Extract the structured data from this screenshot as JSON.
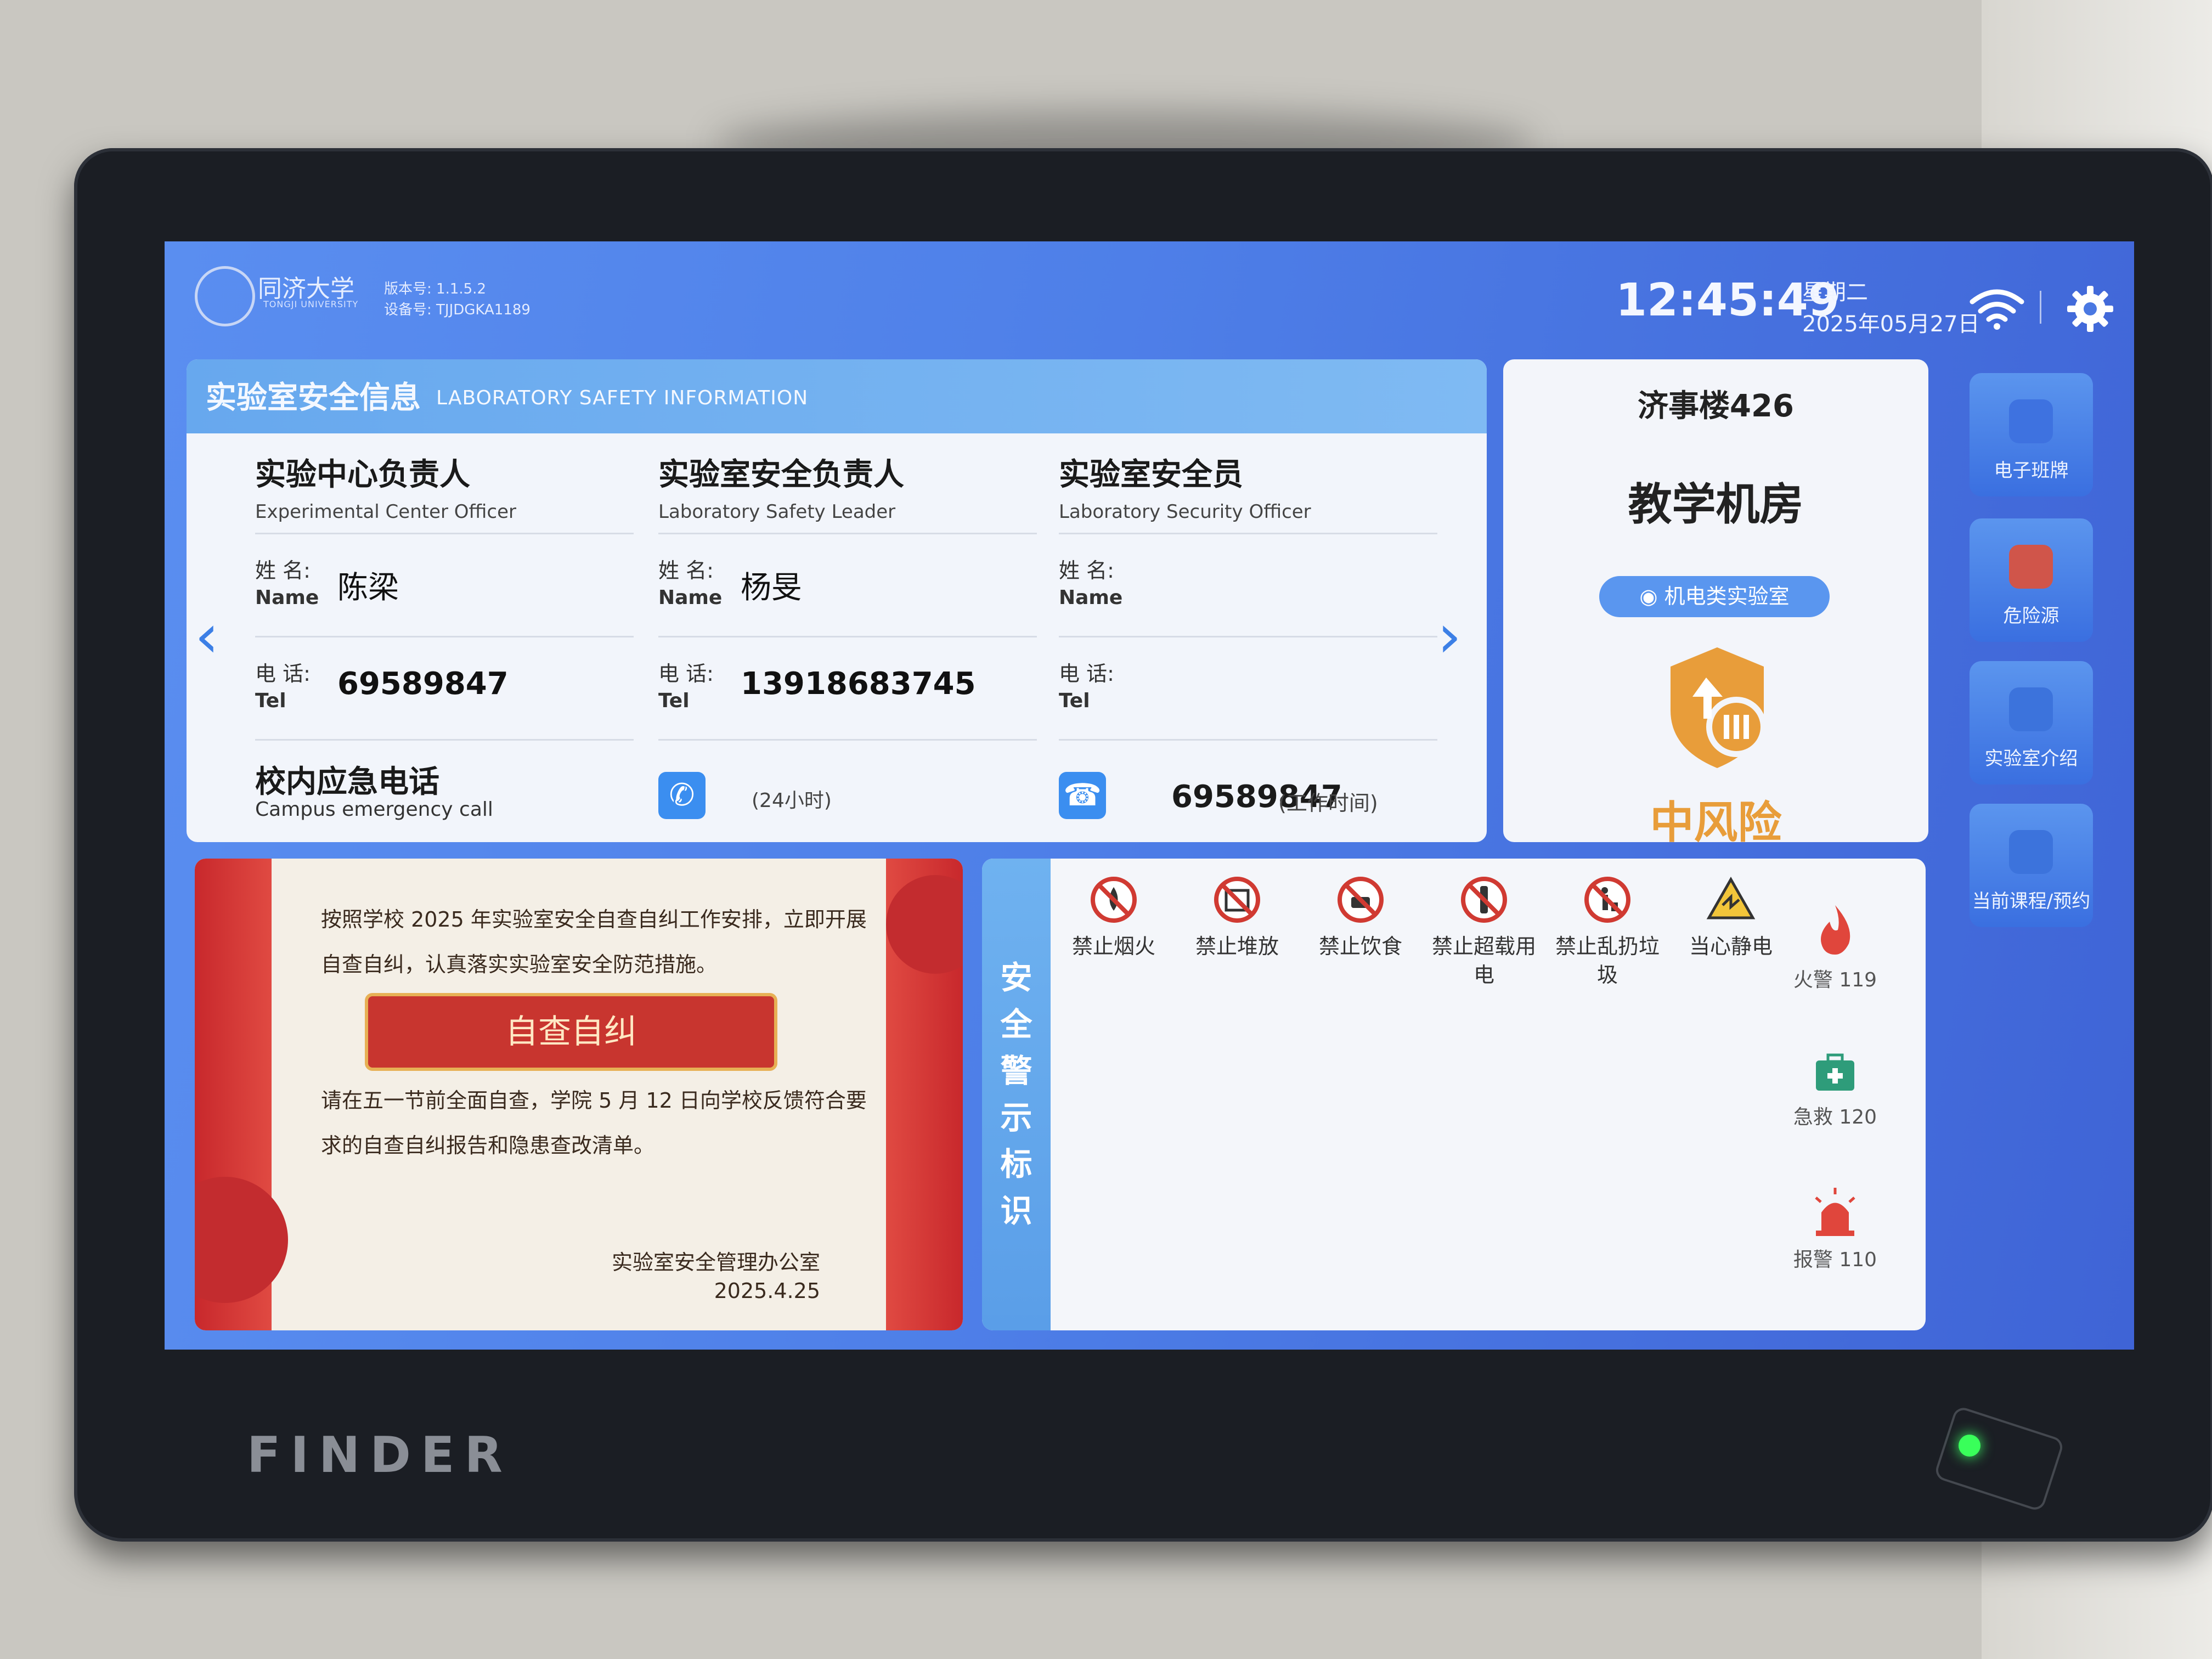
{
  "header": {
    "university_name": "同济大学",
    "university_sub": "TONGJI UNIVERSITY",
    "version_line": "版本号: 1.1.5.2",
    "device_line": "设备号: TJJDGKA1189",
    "time": "12:45:49",
    "weekday": "星期二",
    "date": "2025年05月27日"
  },
  "safety_info": {
    "title_cn": "实验室安全信息",
    "title_en": "LABORATORY SAFETY INFORMATION",
    "name_label_cn": "姓 名:",
    "name_label_en": "Name",
    "tel_label_cn": "电 话:",
    "tel_label_en": "Tel",
    "columns": [
      {
        "title_cn": "实验中心负责人",
        "title_en": "Experimental Center Officer",
        "name": "陈梁",
        "tel": "69589847"
      },
      {
        "title_cn": "实验室安全负责人",
        "title_en": "Laboratory Safety Leader",
        "name": "杨旻",
        "tel": "13918683745"
      },
      {
        "title_cn": "实验室安全员",
        "title_en": "Laboratory Security Officer",
        "name": "",
        "tel": ""
      }
    ],
    "emergency_cn": "校内应急电话",
    "emergency_en": "Campus emergency call",
    "hotline_note": "(24小时)",
    "office_number": "69589847",
    "office_note": "(工作时间)"
  },
  "room": {
    "building": "济事楼426",
    "type": "教学机房",
    "tag": "机电类实验室",
    "risk_level": "中风险",
    "risk_color": "#e89d3a"
  },
  "nav": [
    {
      "label": "电子班牌",
      "icon": "display-icon"
    },
    {
      "label": "危险源",
      "icon": "warning-icon"
    },
    {
      "label": "实验室介绍",
      "icon": "flask-icon"
    },
    {
      "label": "当前课程/预约",
      "icon": "calendar-icon"
    }
  ],
  "notice": {
    "text1": "按照学校 2025 年实验室安全自查自纠工作安排，立即开展自查自纠，认真落实实验室安全防范措施。",
    "button": "自查自纠",
    "text2": "请在五一节前全面自查，学院 5 月 12 日向学校反馈符合要求的自查自纠报告和隐患查改清单。",
    "sign_office": "实验室安全管理办公室",
    "sign_date": "2025.4.25"
  },
  "signs": {
    "side_title": [
      "安",
      "全",
      "警",
      "示",
      "标",
      "识"
    ],
    "items": [
      {
        "label": "禁止烟火"
      },
      {
        "label": "禁止堆放"
      },
      {
        "label": "禁止饮食"
      },
      {
        "label": "禁止超载用电"
      },
      {
        "label": "禁止乱扔垃圾"
      },
      {
        "label": "当心静电"
      }
    ],
    "emergency": [
      {
        "label": "火警 119"
      },
      {
        "label": "急救 120"
      },
      {
        "label": "报警 110"
      }
    ]
  },
  "device_brand": "FINDER"
}
